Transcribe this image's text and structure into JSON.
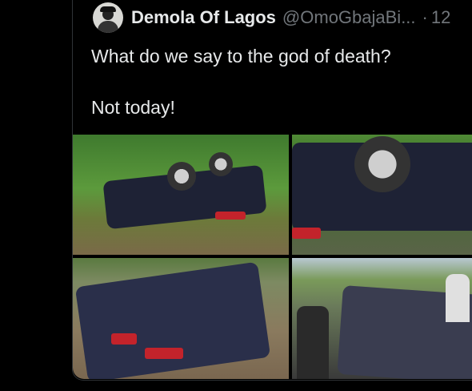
{
  "tweet": {
    "author_name": "Demola Of Lagos",
    "author_handle": "@OmoGbajaBi...",
    "separator": "·",
    "time": "12",
    "text_line1": "What do we say to the god of death?",
    "text_line2": "Not today!"
  },
  "media": {
    "photos": [
      {
        "icon": "overturned-car-photo-1"
      },
      {
        "icon": "overturned-car-photo-2"
      },
      {
        "icon": "wrecked-car-photo-3"
      },
      {
        "icon": "wrecked-car-photo-4"
      }
    ]
  },
  "colors": {
    "background": "#000000",
    "primary_text": "#e7e9ea",
    "secondary_text": "#71767b",
    "border": "#2f3336"
  }
}
